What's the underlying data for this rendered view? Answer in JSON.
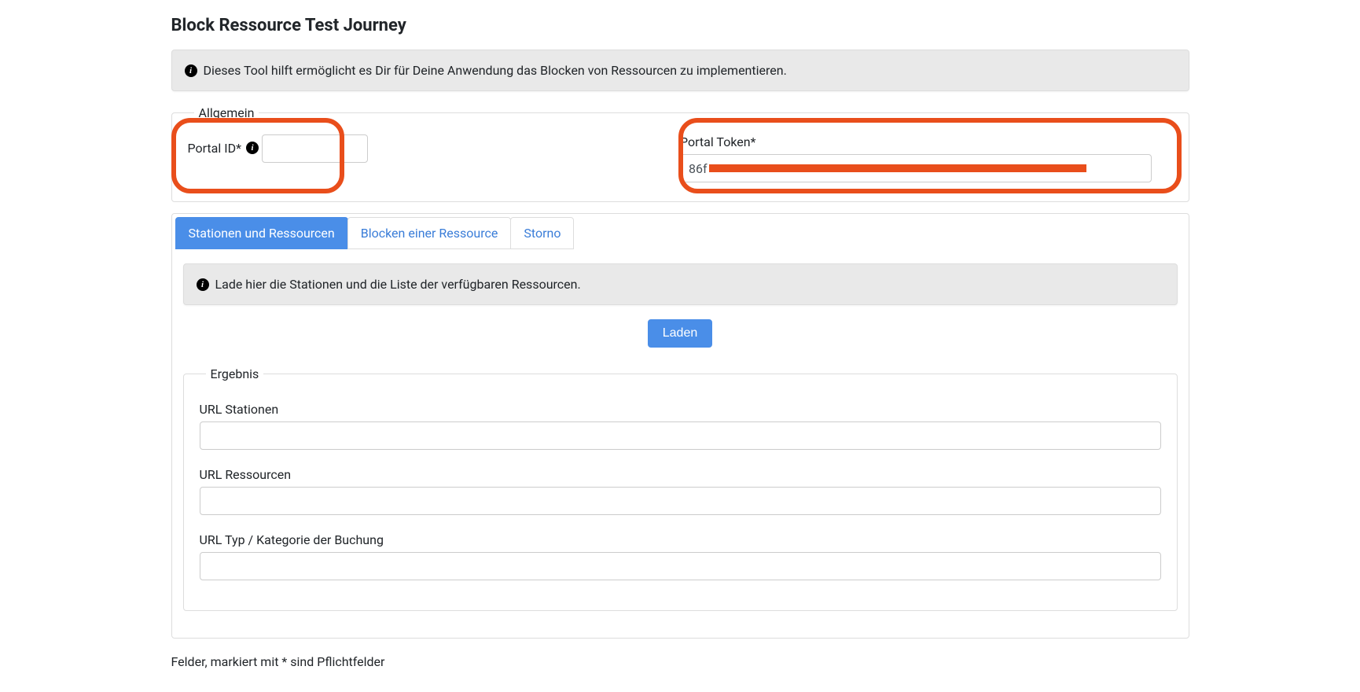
{
  "page": {
    "title": "Block Ressource Test Journey",
    "info": "Dieses Tool hilft ermöglicht es Dir für Deine Anwendung das Blocken von Ressourcen zu implementieren."
  },
  "allgemein": {
    "legend": "Allgemein",
    "portal_id_label": "Portal ID*",
    "portal_id_value": "",
    "portal_token_label": "Portal Token*",
    "portal_token_value_prefix": "86f"
  },
  "tabs": {
    "items": [
      {
        "label": "Stationen und Ressourcen",
        "active": true
      },
      {
        "label": "Blocken einer Ressource",
        "active": false
      },
      {
        "label": "Storno",
        "active": false
      }
    ]
  },
  "tab1": {
    "info": "Lade hier die Stationen und die Liste der verfügbaren Ressourcen.",
    "load_button": "Laden",
    "ergebnis": {
      "legend": "Ergebnis",
      "url_stationen_label": "URL Stationen",
      "url_stationen_value": "",
      "url_ressourcen_label": "URL Ressourcen",
      "url_ressourcen_value": "",
      "url_typ_label": "URL Typ / Kategorie der Buchung",
      "url_typ_value": ""
    }
  },
  "footer": {
    "required_note": "Felder, markiert mit * sind Pflichtfelder"
  }
}
